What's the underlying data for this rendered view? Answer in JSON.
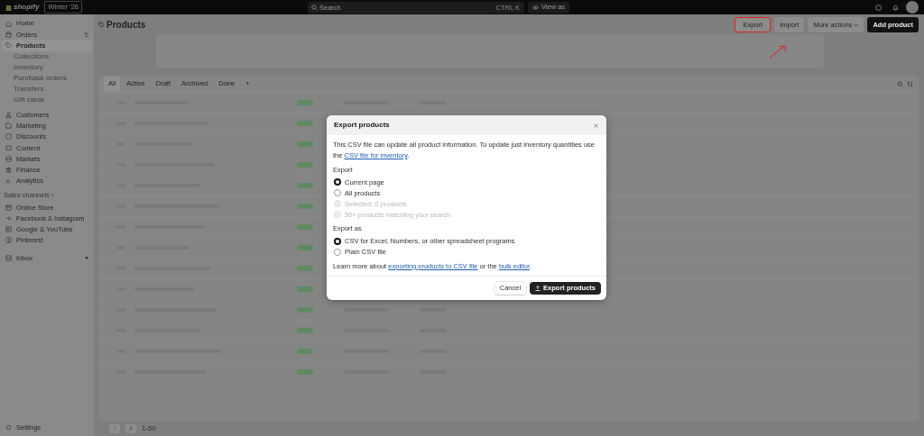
{
  "topbar": {
    "logo": "shopify",
    "edition": "Winter '26",
    "search": {
      "placeholder": "Search",
      "shortcut": "CTRL K"
    },
    "view_as": "View as"
  },
  "sidebar": {
    "items": [
      {
        "label": "Home",
        "selected": false
      },
      {
        "label": "Orders",
        "selected": false,
        "count": "5"
      },
      {
        "label": "Products",
        "selected": true,
        "children": [
          {
            "label": "Collections"
          },
          {
            "label": "Inventory"
          },
          {
            "label": "Purchase orders"
          },
          {
            "label": "Transfers"
          },
          {
            "label": "Gift cards"
          }
        ]
      },
      {
        "label": "Customers",
        "selected": false
      },
      {
        "label": "Marketing",
        "selected": false
      },
      {
        "label": "Discounts",
        "selected": false
      },
      {
        "label": "Content",
        "selected": false
      },
      {
        "label": "Markets",
        "selected": false
      },
      {
        "label": "Finance",
        "selected": false
      },
      {
        "label": "Analytics",
        "selected": false
      }
    ],
    "sales_channels": {
      "heading": "Sales channels ›",
      "items": [
        {
          "label": "Online Store"
        },
        {
          "label": "Facebook & Instagram"
        },
        {
          "label": "Google & YouTube"
        },
        {
          "label": "Pinterest"
        }
      ]
    },
    "inbox": "Inbox",
    "settings": "Settings"
  },
  "page": {
    "title": "Products",
    "actions": [
      {
        "label": "Export",
        "kind": "plain",
        "highlighted": true
      },
      {
        "label": "Import",
        "kind": "plain",
        "highlighted": false
      },
      {
        "label": "More actions",
        "kind": "menu",
        "highlighted": false
      },
      {
        "label": "Add product",
        "kind": "primary",
        "highlighted": false
      }
    ],
    "tabs": [
      {
        "label": "All",
        "selected": true
      },
      {
        "label": "Active",
        "selected": false
      },
      {
        "label": "Draft",
        "selected": false
      },
      {
        "label": "Archived",
        "selected": false
      },
      {
        "label": "Done",
        "selected": false
      },
      {
        "label": "+",
        "selected": false
      }
    ],
    "pagination": "1-50"
  },
  "modal": {
    "title": "Export products",
    "intro": {
      "text": "This CSV file can update all product information. To update just inventory quantities use the ",
      "link": "CSV file for inventory",
      "after": "."
    },
    "groups": [
      {
        "label": "Export",
        "options": [
          {
            "label": "Current page",
            "selected": true,
            "disabled": false
          },
          {
            "label": "All products",
            "selected": false,
            "disabled": false
          },
          {
            "label": "Selected: 0 products",
            "selected": false,
            "disabled": true
          },
          {
            "label": "50+ products matching your search",
            "selected": false,
            "disabled": true
          }
        ]
      },
      {
        "label": "Export as",
        "options": [
          {
            "label": "CSV for Excel, Numbers, or other spreadsheet programs",
            "selected": true,
            "disabled": false
          },
          {
            "label": "Plain CSV file",
            "selected": false,
            "disabled": false
          }
        ]
      }
    ],
    "note": [
      {
        "text": "Learn more about "
      },
      {
        "link": "exporting products to CSV file"
      },
      {
        "text": " or the "
      },
      {
        "link": "bulk editor"
      },
      {
        "text": "."
      }
    ],
    "buttons": [
      {
        "label": "Cancel",
        "kind": "secondary"
      },
      {
        "label": "Export products",
        "kind": "primary"
      }
    ]
  }
}
